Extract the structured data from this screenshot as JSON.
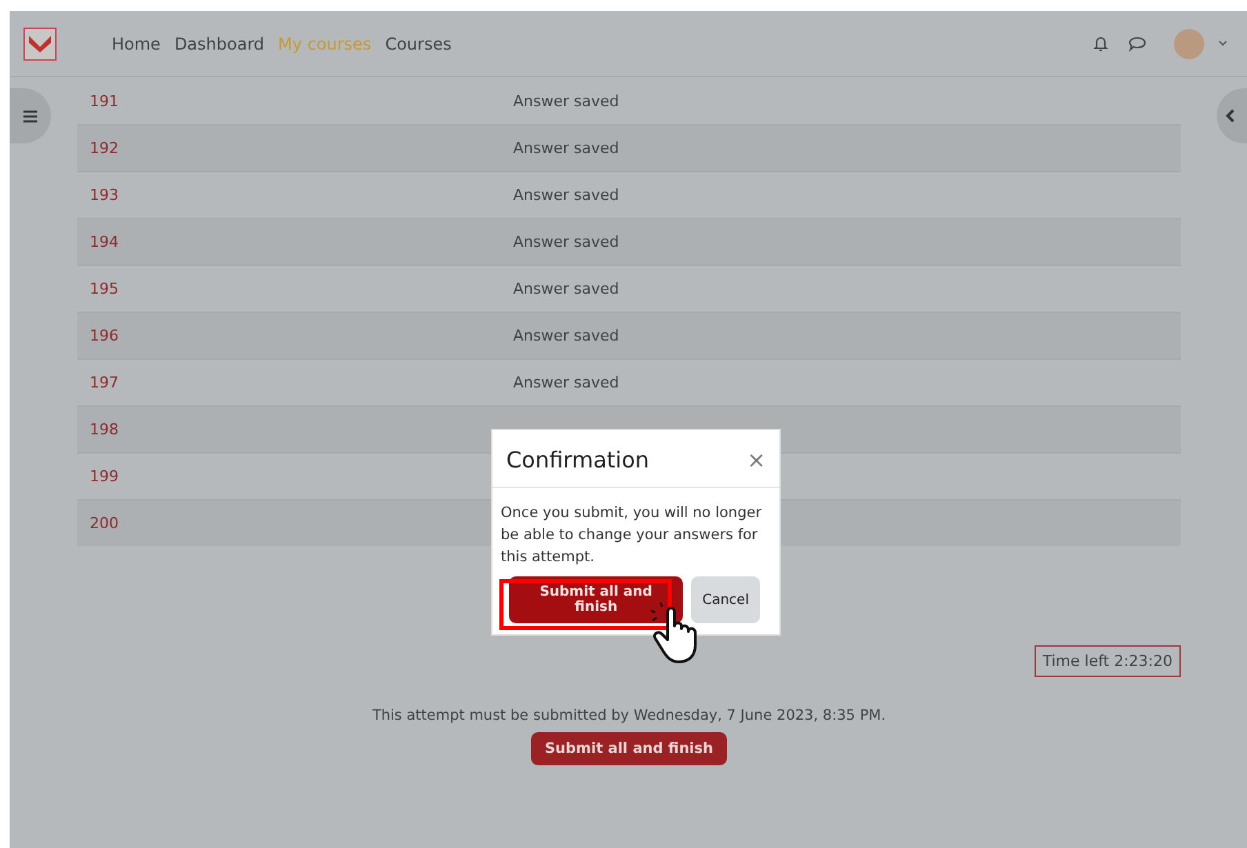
{
  "navbar": {
    "items": [
      {
        "label": "Home",
        "selected": false
      },
      {
        "label": "Dashboard",
        "selected": false
      },
      {
        "label": "My courses",
        "selected": true
      },
      {
        "label": "Courses",
        "selected": false
      }
    ]
  },
  "questions": [
    {
      "number": "191",
      "status": "Answer saved"
    },
    {
      "number": "192",
      "status": "Answer saved"
    },
    {
      "number": "193",
      "status": "Answer saved"
    },
    {
      "number": "194",
      "status": "Answer saved"
    },
    {
      "number": "195",
      "status": "Answer saved"
    },
    {
      "number": "196",
      "status": "Answer saved"
    },
    {
      "number": "197",
      "status": "Answer saved"
    },
    {
      "number": "198"
    },
    {
      "number": "199"
    },
    {
      "number": "200"
    }
  ],
  "timer": "Time left 2:23:20",
  "deadline": "This attempt must be submitted by Wednesday, 7 June 2023, 8:35 PM.",
  "submit_button": "Submit all and finish",
  "dialog": {
    "title": "Confirmation",
    "close": "×",
    "message": "Once you submit, you will no longer be able to change your answers for this attempt.",
    "confirm": "Submit all and finish",
    "cancel": "Cancel"
  }
}
